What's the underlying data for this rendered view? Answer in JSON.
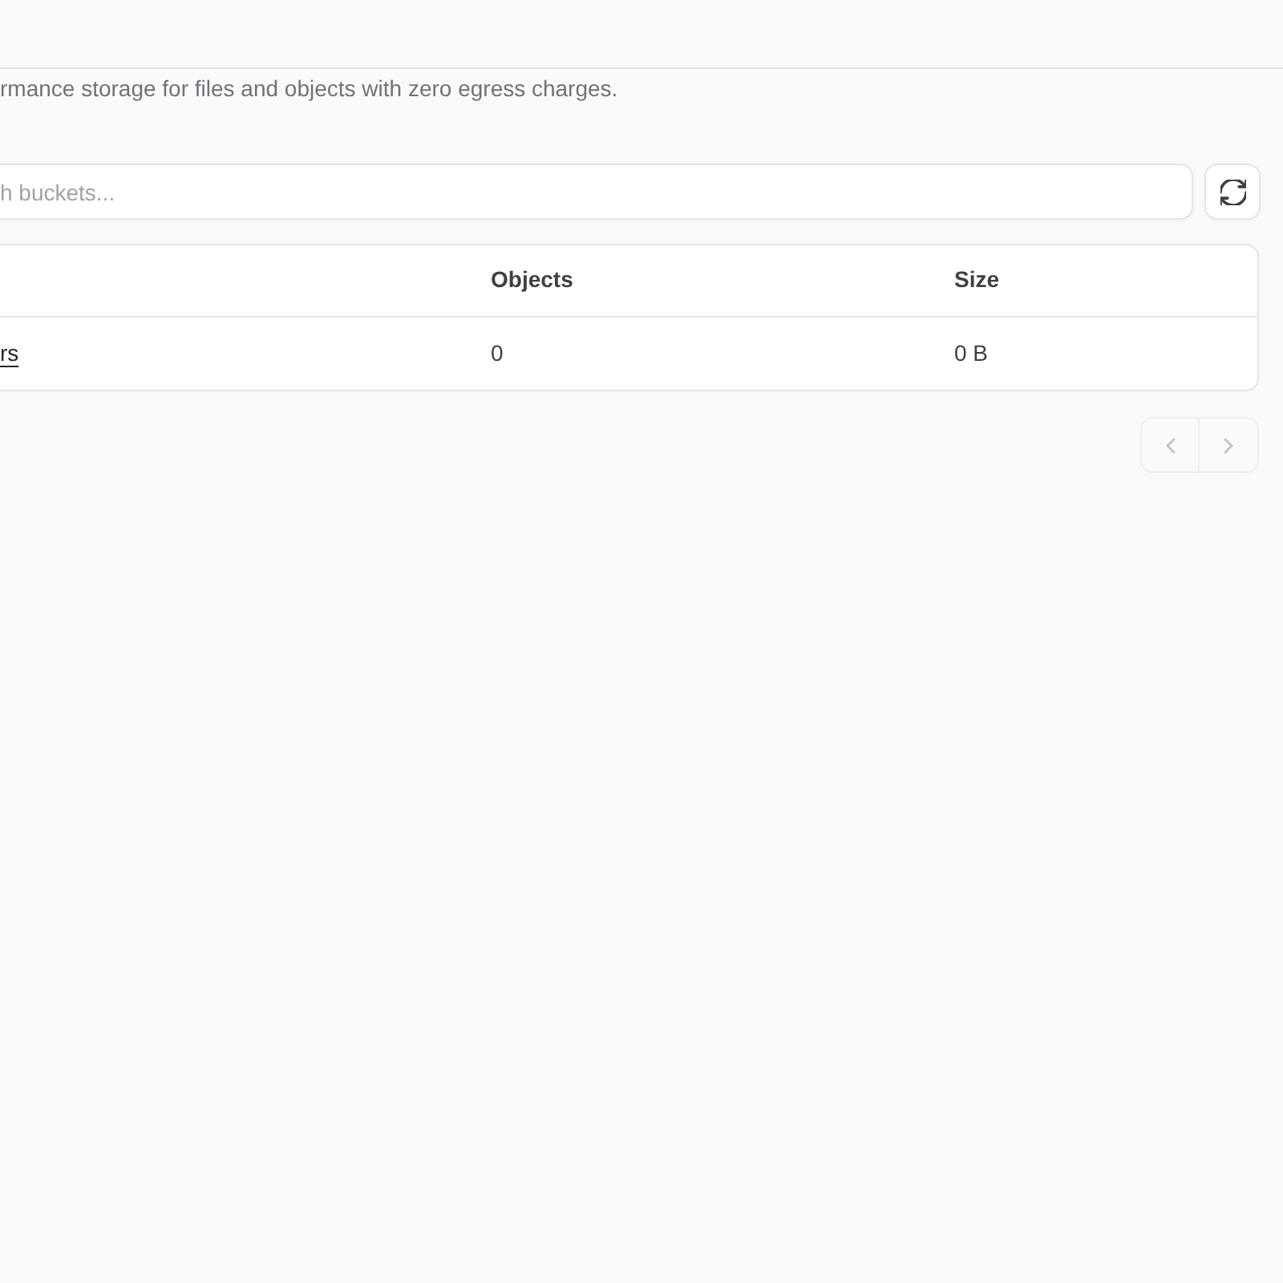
{
  "description": "rmance storage for files and objects with zero egress charges.",
  "search": {
    "placeholder": "h buckets..."
  },
  "table": {
    "columns": [
      {
        "label": "Objects"
      },
      {
        "label": "Size"
      }
    ],
    "rows": [
      {
        "column_1": "rs",
        "objects": "0",
        "size": "0 B"
      }
    ]
  },
  "pagination": {
    "previous": {
      "disabled": true
    },
    "next": {
      "disabled": true
    }
  }
}
